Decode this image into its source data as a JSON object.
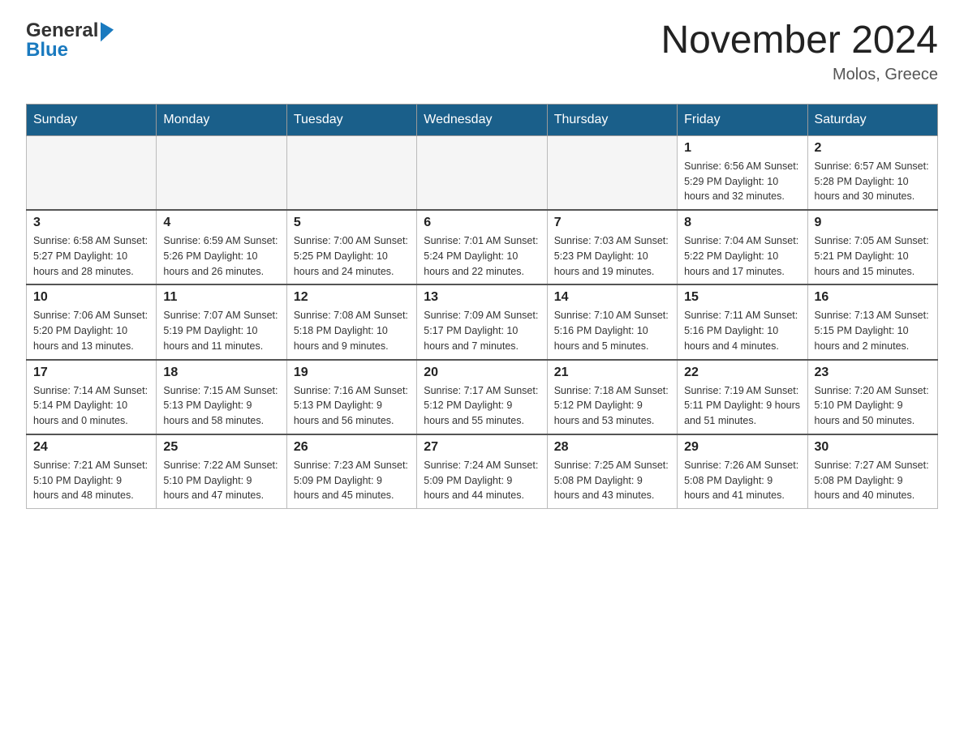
{
  "header": {
    "logo_line1": "General",
    "logo_line2": "Blue",
    "main_title": "November 2024",
    "subtitle": "Molos, Greece"
  },
  "weekdays": [
    "Sunday",
    "Monday",
    "Tuesday",
    "Wednesday",
    "Thursday",
    "Friday",
    "Saturday"
  ],
  "weeks": [
    [
      {
        "day": "",
        "info": ""
      },
      {
        "day": "",
        "info": ""
      },
      {
        "day": "",
        "info": ""
      },
      {
        "day": "",
        "info": ""
      },
      {
        "day": "",
        "info": ""
      },
      {
        "day": "1",
        "info": "Sunrise: 6:56 AM\nSunset: 5:29 PM\nDaylight: 10 hours\nand 32 minutes."
      },
      {
        "day": "2",
        "info": "Sunrise: 6:57 AM\nSunset: 5:28 PM\nDaylight: 10 hours\nand 30 minutes."
      }
    ],
    [
      {
        "day": "3",
        "info": "Sunrise: 6:58 AM\nSunset: 5:27 PM\nDaylight: 10 hours\nand 28 minutes."
      },
      {
        "day": "4",
        "info": "Sunrise: 6:59 AM\nSunset: 5:26 PM\nDaylight: 10 hours\nand 26 minutes."
      },
      {
        "day": "5",
        "info": "Sunrise: 7:00 AM\nSunset: 5:25 PM\nDaylight: 10 hours\nand 24 minutes."
      },
      {
        "day": "6",
        "info": "Sunrise: 7:01 AM\nSunset: 5:24 PM\nDaylight: 10 hours\nand 22 minutes."
      },
      {
        "day": "7",
        "info": "Sunrise: 7:03 AM\nSunset: 5:23 PM\nDaylight: 10 hours\nand 19 minutes."
      },
      {
        "day": "8",
        "info": "Sunrise: 7:04 AM\nSunset: 5:22 PM\nDaylight: 10 hours\nand 17 minutes."
      },
      {
        "day": "9",
        "info": "Sunrise: 7:05 AM\nSunset: 5:21 PM\nDaylight: 10 hours\nand 15 minutes."
      }
    ],
    [
      {
        "day": "10",
        "info": "Sunrise: 7:06 AM\nSunset: 5:20 PM\nDaylight: 10 hours\nand 13 minutes."
      },
      {
        "day": "11",
        "info": "Sunrise: 7:07 AM\nSunset: 5:19 PM\nDaylight: 10 hours\nand 11 minutes."
      },
      {
        "day": "12",
        "info": "Sunrise: 7:08 AM\nSunset: 5:18 PM\nDaylight: 10 hours\nand 9 minutes."
      },
      {
        "day": "13",
        "info": "Sunrise: 7:09 AM\nSunset: 5:17 PM\nDaylight: 10 hours\nand 7 minutes."
      },
      {
        "day": "14",
        "info": "Sunrise: 7:10 AM\nSunset: 5:16 PM\nDaylight: 10 hours\nand 5 minutes."
      },
      {
        "day": "15",
        "info": "Sunrise: 7:11 AM\nSunset: 5:16 PM\nDaylight: 10 hours\nand 4 minutes."
      },
      {
        "day": "16",
        "info": "Sunrise: 7:13 AM\nSunset: 5:15 PM\nDaylight: 10 hours\nand 2 minutes."
      }
    ],
    [
      {
        "day": "17",
        "info": "Sunrise: 7:14 AM\nSunset: 5:14 PM\nDaylight: 10 hours\nand 0 minutes."
      },
      {
        "day": "18",
        "info": "Sunrise: 7:15 AM\nSunset: 5:13 PM\nDaylight: 9 hours\nand 58 minutes."
      },
      {
        "day": "19",
        "info": "Sunrise: 7:16 AM\nSunset: 5:13 PM\nDaylight: 9 hours\nand 56 minutes."
      },
      {
        "day": "20",
        "info": "Sunrise: 7:17 AM\nSunset: 5:12 PM\nDaylight: 9 hours\nand 55 minutes."
      },
      {
        "day": "21",
        "info": "Sunrise: 7:18 AM\nSunset: 5:12 PM\nDaylight: 9 hours\nand 53 minutes."
      },
      {
        "day": "22",
        "info": "Sunrise: 7:19 AM\nSunset: 5:11 PM\nDaylight: 9 hours\nand 51 minutes."
      },
      {
        "day": "23",
        "info": "Sunrise: 7:20 AM\nSunset: 5:10 PM\nDaylight: 9 hours\nand 50 minutes."
      }
    ],
    [
      {
        "day": "24",
        "info": "Sunrise: 7:21 AM\nSunset: 5:10 PM\nDaylight: 9 hours\nand 48 minutes."
      },
      {
        "day": "25",
        "info": "Sunrise: 7:22 AM\nSunset: 5:10 PM\nDaylight: 9 hours\nand 47 minutes."
      },
      {
        "day": "26",
        "info": "Sunrise: 7:23 AM\nSunset: 5:09 PM\nDaylight: 9 hours\nand 45 minutes."
      },
      {
        "day": "27",
        "info": "Sunrise: 7:24 AM\nSunset: 5:09 PM\nDaylight: 9 hours\nand 44 minutes."
      },
      {
        "day": "28",
        "info": "Sunrise: 7:25 AM\nSunset: 5:08 PM\nDaylight: 9 hours\nand 43 minutes."
      },
      {
        "day": "29",
        "info": "Sunrise: 7:26 AM\nSunset: 5:08 PM\nDaylight: 9 hours\nand 41 minutes."
      },
      {
        "day": "30",
        "info": "Sunrise: 7:27 AM\nSunset: 5:08 PM\nDaylight: 9 hours\nand 40 minutes."
      }
    ]
  ]
}
